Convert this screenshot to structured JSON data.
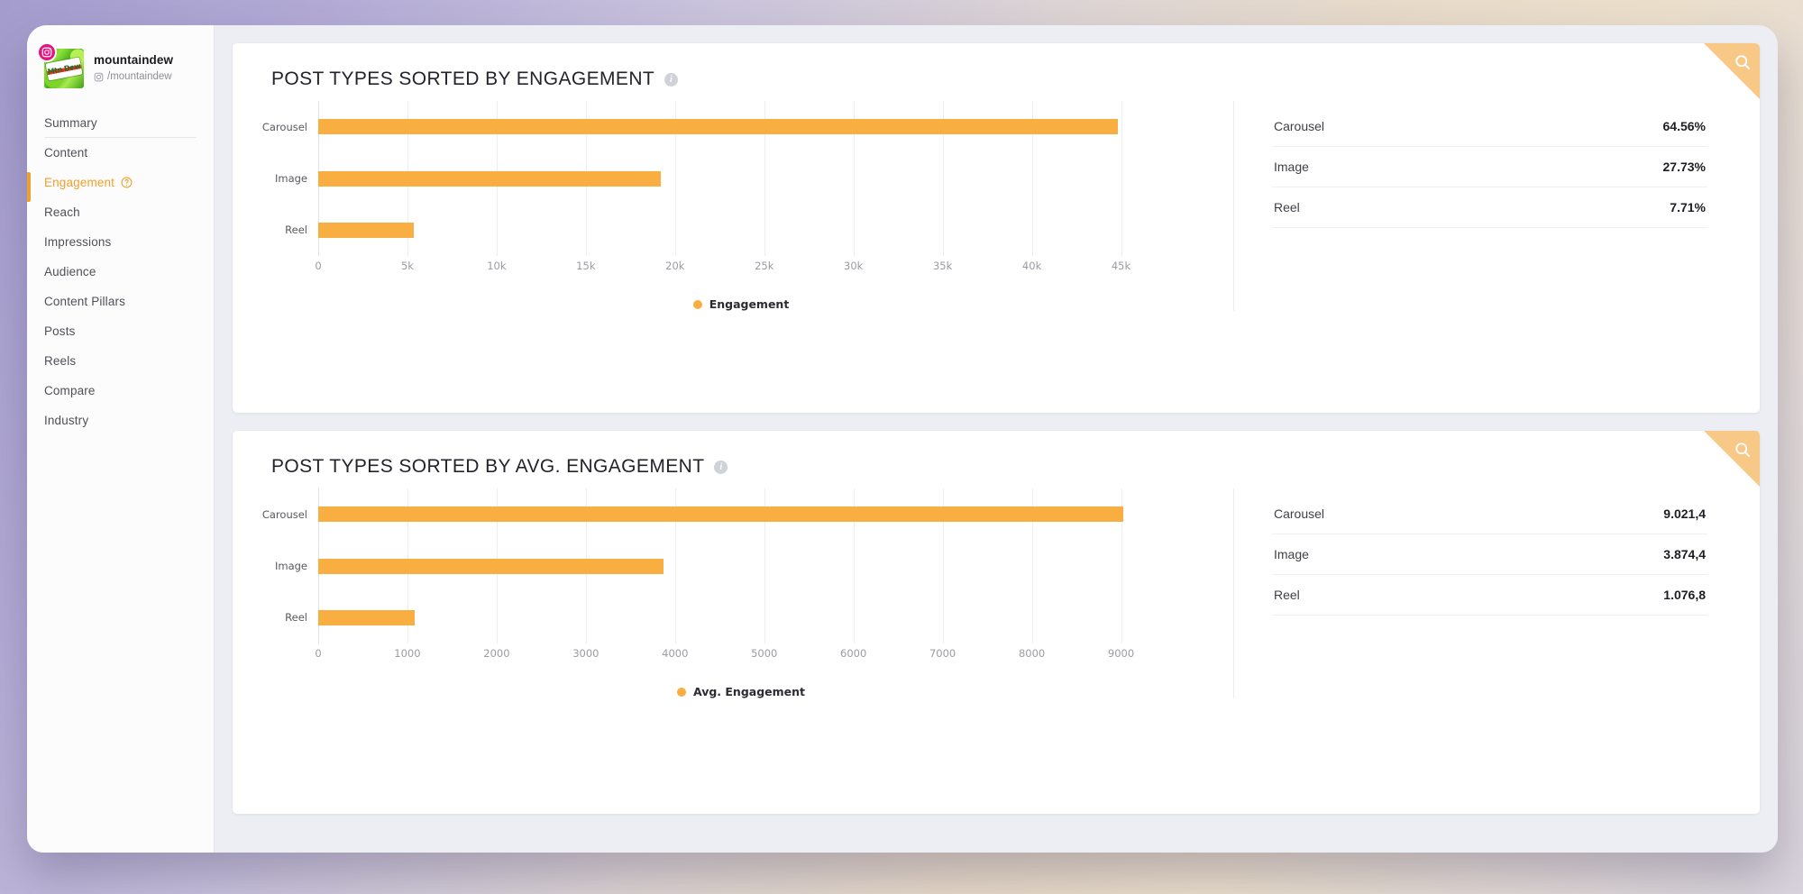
{
  "sidebar": {
    "profile": {
      "name": "mountaindew",
      "handle": "/mountaindew",
      "avatar_icon": "mountain-dew-logo",
      "network_badge_icon": "instagram-icon",
      "handle_icon": "instagram-outline-icon"
    },
    "items": [
      {
        "label": "Summary",
        "active": false
      },
      {
        "label": "Content",
        "active": false
      },
      {
        "label": "Engagement",
        "active": true,
        "help_icon": "question-circle-icon"
      },
      {
        "label": "Reach",
        "active": false
      },
      {
        "label": "Impressions",
        "active": false
      },
      {
        "label": "Audience",
        "active": false
      },
      {
        "label": "Content Pillars",
        "active": false
      },
      {
        "label": "Posts",
        "active": false
      },
      {
        "label": "Reels",
        "active": false
      },
      {
        "label": "Compare",
        "active": false
      },
      {
        "label": "Industry",
        "active": false
      }
    ]
  },
  "cards": [
    {
      "title": "POST TYPES SORTED BY ENGAGEMENT",
      "info_icon": "info-icon",
      "search_icon": "search-icon",
      "table": {
        "rows": [
          {
            "name": "Carousel",
            "value": "64.56%"
          },
          {
            "name": "Image",
            "value": "27.73%"
          },
          {
            "name": "Reel",
            "value": "7.71%"
          }
        ]
      }
    },
    {
      "title": "POST TYPES SORTED BY AVG. ENGAGEMENT",
      "info_icon": "info-icon",
      "search_icon": "search-icon",
      "table": {
        "rows": [
          {
            "name": "Carousel",
            "value": "9.021,4"
          },
          {
            "name": "Image",
            "value": "3.874,4"
          },
          {
            "name": "Reel",
            "value": "1.076,8"
          }
        ]
      }
    }
  ],
  "chart_data": [
    {
      "type": "bar",
      "orientation": "horizontal",
      "title": "POST TYPES SORTED BY ENGAGEMENT",
      "categories": [
        "Carousel",
        "Image",
        "Reel"
      ],
      "values": [
        44800,
        19200,
        5350
      ],
      "series": [
        {
          "name": "Engagement",
          "values": [
            44800,
            19200,
            5350
          ]
        }
      ],
      "tick_labels": [
        "0",
        "5k",
        "10k",
        "15k",
        "20k",
        "25k",
        "30k",
        "35k",
        "40k",
        "45k"
      ],
      "tick_values": [
        0,
        5000,
        10000,
        15000,
        20000,
        25000,
        30000,
        35000,
        40000,
        45000
      ],
      "xlim": [
        0,
        47500
      ],
      "ylabel": "",
      "xlabel": "",
      "legend": [
        "Engagement"
      ],
      "legend_position": "bottom",
      "grid": true,
      "color": "#f9ae41"
    },
    {
      "type": "bar",
      "orientation": "horizontal",
      "title": "POST TYPES SORTED BY AVG. ENGAGEMENT",
      "categories": [
        "Carousel",
        "Image",
        "Reel"
      ],
      "values": [
        9021.4,
        3874.4,
        1076.8
      ],
      "series": [
        {
          "name": "Avg. Engagement",
          "values": [
            9021.4,
            3874.4,
            1076.8
          ]
        }
      ],
      "tick_labels": [
        "0",
        "1000",
        "2000",
        "3000",
        "4000",
        "5000",
        "6000",
        "7000",
        "8000",
        "9000"
      ],
      "tick_values": [
        0,
        1000,
        2000,
        3000,
        4000,
        5000,
        6000,
        7000,
        8000,
        9000
      ],
      "xlim": [
        0,
        9500
      ],
      "ylabel": "",
      "xlabel": "",
      "legend": [
        "Avg. Engagement"
      ],
      "legend_position": "bottom",
      "grid": true,
      "color": "#f9ae41"
    }
  ],
  "colors": {
    "accent_orange": "#f9ae41",
    "active_nav": "#f0a02e",
    "ribbon": "#f8c887",
    "instagram_pink": "#e8117f"
  }
}
